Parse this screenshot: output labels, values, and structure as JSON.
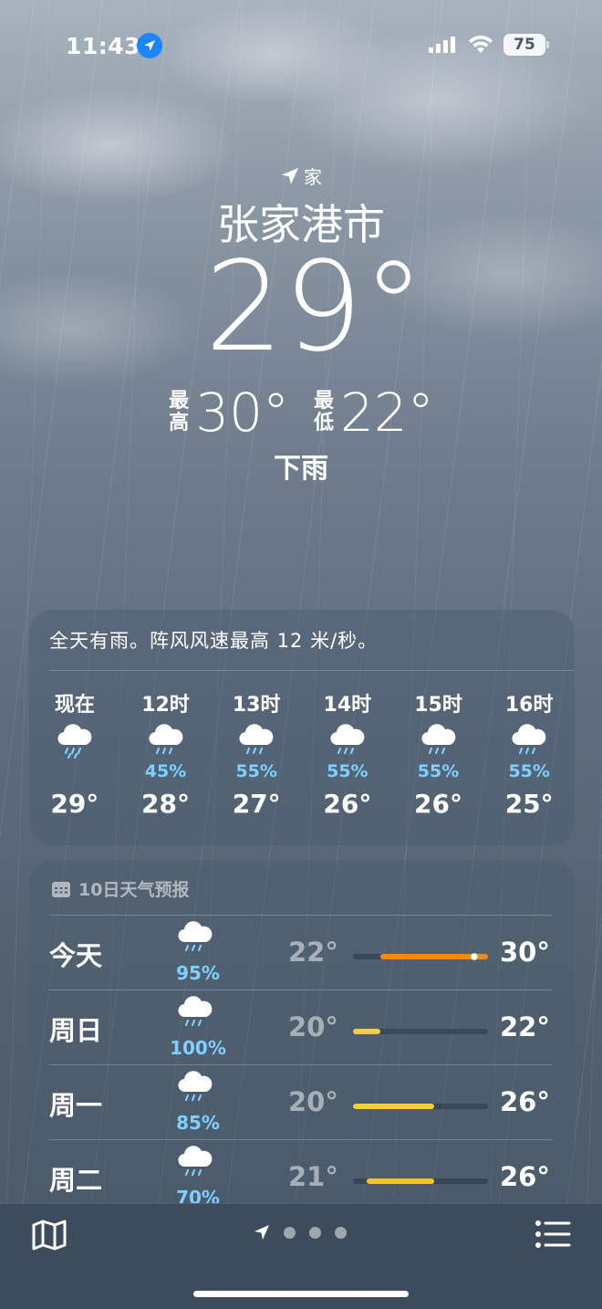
{
  "status_bar": {
    "time": "11:43",
    "battery": "75"
  },
  "header": {
    "home_label": "家",
    "city": "张家港市",
    "current_temp": "29°",
    "high_label": "最高",
    "high": "30°",
    "low_label": "最低",
    "low": "22°",
    "condition": "下雨"
  },
  "hourly": {
    "summary": "全天有雨。阵风风速最高 12 米/秒。",
    "items": [
      {
        "time": "现在",
        "icon": "cloud-rain-icon",
        "pct": "",
        "temp": "29°"
      },
      {
        "time": "12时",
        "icon": "cloud-rain-icon",
        "pct": "45%",
        "temp": "28°"
      },
      {
        "time": "13时",
        "icon": "cloud-rain-icon",
        "pct": "55%",
        "temp": "27°"
      },
      {
        "time": "14时",
        "icon": "cloud-rain-icon",
        "pct": "55%",
        "temp": "26°"
      },
      {
        "time": "15时",
        "icon": "cloud-rain-icon",
        "pct": "55%",
        "temp": "26°"
      },
      {
        "time": "16时",
        "icon": "cloud-rain-icon",
        "pct": "55%",
        "temp": "25°"
      }
    ]
  },
  "daily": {
    "header": "10日天气预报",
    "range_min": 20,
    "range_max": 30,
    "days": [
      {
        "name": "今天",
        "icon": "cloud-rain-icon",
        "pct": "95%",
        "low": "22°",
        "high": "30°",
        "low_val": 22,
        "high_val": 30,
        "current_val": 29,
        "color": "#f08a14"
      },
      {
        "name": "周日",
        "icon": "cloud-rain-icon",
        "pct": "100%",
        "low": "20°",
        "high": "22°",
        "low_val": 20,
        "high_val": 22,
        "color": "#f2cf3a"
      },
      {
        "name": "周一",
        "icon": "cloud-rain-icon",
        "pct": "85%",
        "low": "20°",
        "high": "26°",
        "low_val": 20,
        "high_val": 26,
        "color": "#f2cf3a"
      },
      {
        "name": "周二",
        "icon": "cloud-rain-icon",
        "pct": "70%",
        "low": "21°",
        "high": "26°",
        "low_val": 21,
        "high_val": 26,
        "color": "#f5c524"
      }
    ]
  },
  "colors": {
    "precip": "#7fd0ff",
    "location_badge": "#1a86ff"
  },
  "bottom_bar": {
    "left_icon": "map-icon",
    "right_icon": "list-icon",
    "page_count": 3
  }
}
